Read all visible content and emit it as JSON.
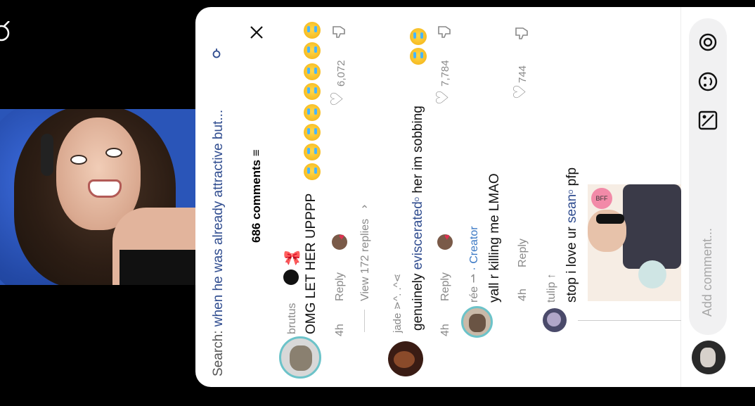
{
  "search": {
    "prefix": "Search:",
    "query": "when he was already attractive but..."
  },
  "comments_count": "686 comments",
  "comments": [
    {
      "user": "brutus",
      "text": "OMG LET HER UPPPP",
      "time": "4h",
      "reply": "Reply",
      "likes": "6,072",
      "view_replies": "View 172 replies"
    },
    {
      "user": "jade ⋗^. .^⋖",
      "text_a": "genuinely",
      "text_link": "eviscerated",
      "text_b": "her im sobbing",
      "time": "4h",
      "reply": "Reply",
      "likes": "7,784"
    },
    {
      "user": "rée ⇀",
      "badge": "· Creator",
      "text": "yall r killing me LMAO",
      "time": "4h",
      "reply": "Reply",
      "likes": "744"
    },
    {
      "user": "tulip ↑",
      "text_a": "stop i love ur",
      "text_link": "sean",
      "text_b": "pfp"
    }
  ],
  "input": {
    "placeholder": "Add comment..."
  },
  "colors": {
    "link": "#2f4c8f",
    "creator": "#3a78c4",
    "panel": "#ffffff",
    "input_bg": "#f1f1f2"
  }
}
